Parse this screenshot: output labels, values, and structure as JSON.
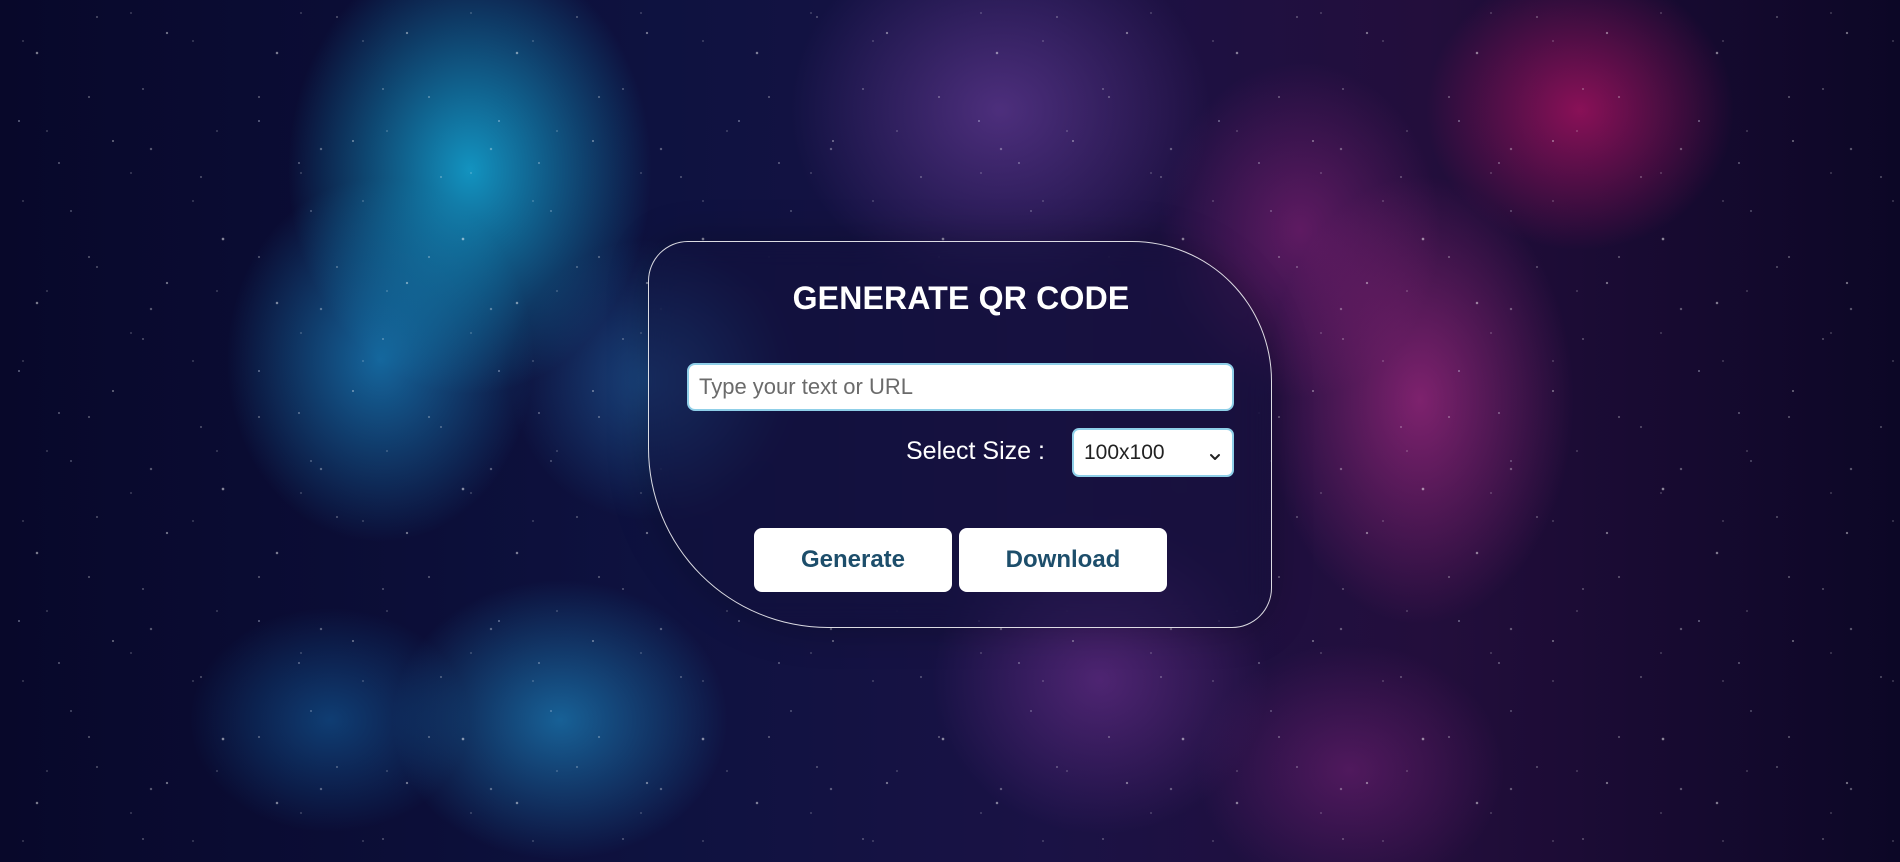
{
  "card": {
    "title": "GENERATE QR CODE",
    "text_input": {
      "placeholder": "Type your text or URL",
      "value": ""
    },
    "size_label": "Select Size :",
    "size_select": {
      "selected": "100x100",
      "icon": "chevron-down-icon"
    },
    "buttons": {
      "generate": "Generate",
      "download": "Download"
    }
  },
  "colors": {
    "button_text": "#1d4e6b",
    "input_border": "#8fcfe8",
    "title_text": "#ffffff"
  }
}
